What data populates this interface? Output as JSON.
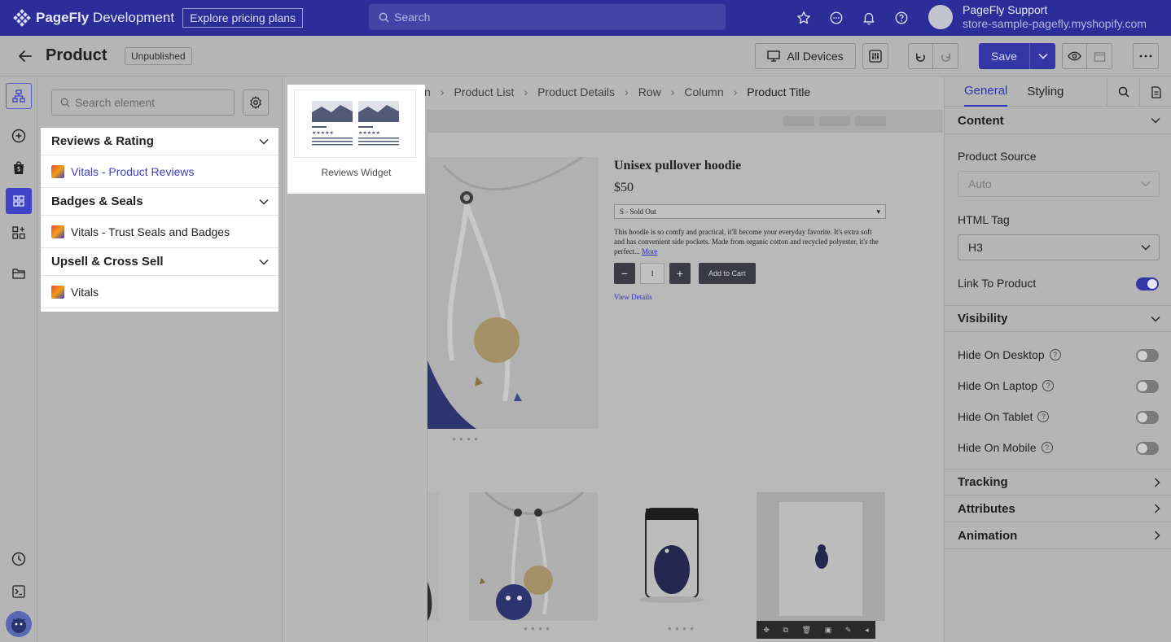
{
  "topbar": {
    "brand": "PageFly",
    "brand_suffix": " Development",
    "pricing_label": "Explore pricing plans",
    "search_placeholder": "Search",
    "user_name": "PageFly Support",
    "user_store": "store-sample-pagefly.myshopify.com"
  },
  "toolbar": {
    "page_title": "Product",
    "status": "Unpublished",
    "devices_label": "All Devices",
    "save_label": "Save"
  },
  "panel": {
    "search_placeholder": "Search element",
    "categories": [
      {
        "title": "Reviews & Rating",
        "item": "Vitals - Product Reviews"
      },
      {
        "title": "Badges & Seals",
        "item": "Vitals - Trust Seals and Badges"
      },
      {
        "title": "Upsell & Cross Sell",
        "item": "Vitals"
      }
    ],
    "widget_label": "Reviews Widget"
  },
  "canvas": {
    "breadcrumb": [
      "n",
      "Product List",
      "Product Details",
      "Row",
      "Column",
      "Product Title"
    ],
    "product": {
      "title": "Unisex pullover hoodie",
      "price": "$50",
      "variant": "S - Sold Out",
      "description": "This hoodie is so comfy and practical, it'll become your everyday favorite. It's extra soft and has convenient side pockets. Made from organic cotton and recycled polyester, it's the perfect...",
      "more": "More",
      "qty_minus": "−",
      "qty_value": "1",
      "qty_plus": "+",
      "add_to_cart": "Add to Cart",
      "view_details": "View Details"
    }
  },
  "rpanel": {
    "tabs": [
      "General",
      "Styling"
    ],
    "content_title": "Content",
    "product_source_label": "Product Source",
    "product_source_value": "Auto",
    "html_tag_label": "HTML Tag",
    "html_tag_value": "H3",
    "link_label": "Link To Product",
    "link_on": true,
    "visibility_title": "Visibility",
    "hide_desktop": "Hide On Desktop",
    "hide_laptop": "Hide On Laptop",
    "hide_tablet": "Hide On Tablet",
    "hide_mobile": "Hide On Mobile",
    "tracking": "Tracking",
    "attributes": "Attributes",
    "animation": "Animation"
  },
  "colors": {
    "brand": "#2b2d99",
    "accent": "#3b3fc5",
    "save": "#3337a6"
  }
}
